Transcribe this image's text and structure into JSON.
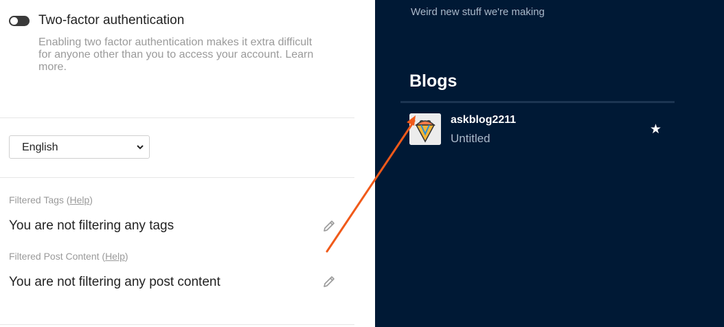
{
  "colors": {
    "right_panel_bg": "#001935",
    "accent_arrow": "#f05a1a",
    "muted_text": "#9a9a9a",
    "toggle_off": "#3a3a3a"
  },
  "two_factor": {
    "title": "Two-factor authentication",
    "description": "Enabling two factor authentication makes it extra difficult for anyone other than you to access your account. Learn more.",
    "enabled": false
  },
  "language": {
    "selected": "English",
    "icon": "chevron-down-icon"
  },
  "filtered_tags": {
    "label": "Filtered Tags (",
    "help": "Help",
    "close": ")",
    "value": "You are not filtering any tags",
    "icon": "pencil-icon"
  },
  "filtered_post_content": {
    "label": "Filtered Post Content (",
    "help": "Help",
    "close": ")",
    "value": "You are not filtering any post content",
    "icon": "pencil-icon"
  },
  "sidebar": {
    "subtitle": "Weird new stuff we're making",
    "blogs_heading": "Blogs",
    "blogs": [
      {
        "name": "askblog2211",
        "title": "Untitled",
        "star": "★",
        "avatar_icon": "ice-cream-cone-icon"
      }
    ]
  }
}
